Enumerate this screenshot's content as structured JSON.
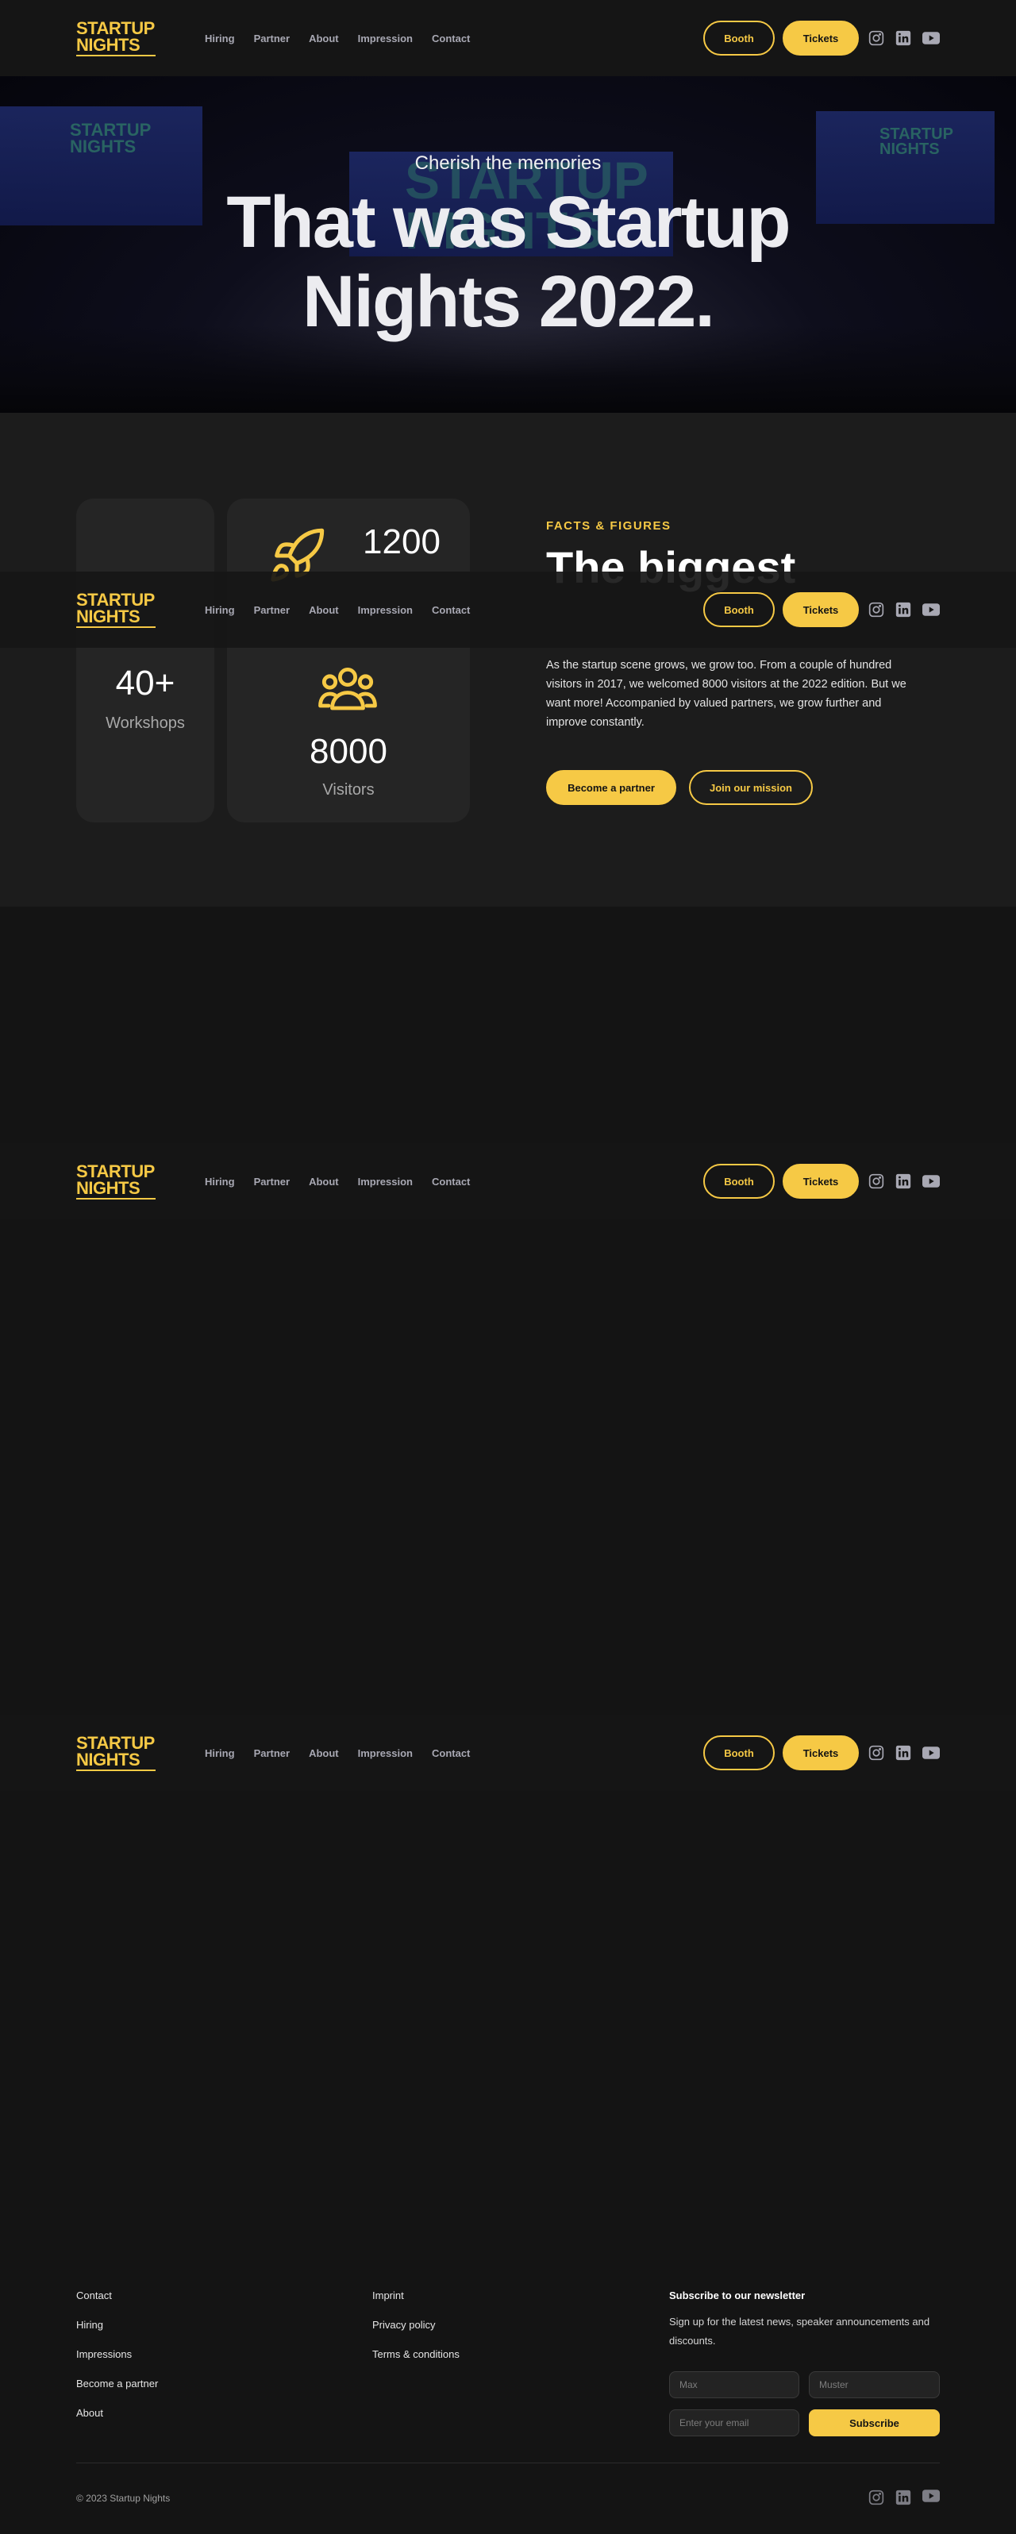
{
  "brand": {
    "line1": "STARTUP",
    "line2": "NIGHTS",
    "accent": "#f6c945"
  },
  "nav": {
    "links": [
      "Hiring",
      "Partner",
      "About",
      "Impression",
      "Contact"
    ],
    "booth": "Booth",
    "tickets": "Tickets",
    "social": [
      "instagram-icon",
      "linkedin-icon",
      "youtube-icon"
    ]
  },
  "hero": {
    "subtitle": "Cherish the memories",
    "title_line1": "That was Startup",
    "title_line2": "Nights 2022.",
    "screen_text": {
      "line1": "STARTUP",
      "line2": "NIGHTS"
    }
  },
  "facts": {
    "eyebrow": "FACTS & FIGURES",
    "heading": "The biggest",
    "body": "As the startup scene grows, we grow too. From a couple of hundred visitors in 2017, we welcomed 8000 visitors at the 2022 edition. But we want more! Accompanied by valued partners, we grow further and improve constantly.",
    "partner_button": "Become a partner",
    "mission_button": "Join our mission",
    "stats": {
      "startups": {
        "value": "1200",
        "icon": "rocket-icon"
      },
      "workshops": {
        "value": "40+",
        "label": "Workshops"
      },
      "visitors": {
        "value": "8000",
        "label": "Visitors",
        "icon": "users-icon"
      }
    }
  },
  "footer": {
    "col1": [
      "Contact",
      "Hiring",
      "Impressions",
      "Become a partner",
      "About"
    ],
    "col2": [
      "Imprint",
      "Privacy policy",
      "Terms & conditions"
    ],
    "newsletter": {
      "title": "Subscribe to our newsletter",
      "description": "Sign up for the latest news, speaker announcements and discounts.",
      "first_name_placeholder": "Max",
      "last_name_placeholder": "Muster",
      "email_placeholder": "Enter your email",
      "button": "Subscribe"
    },
    "copyright": "© 2023 Startup Nights"
  }
}
